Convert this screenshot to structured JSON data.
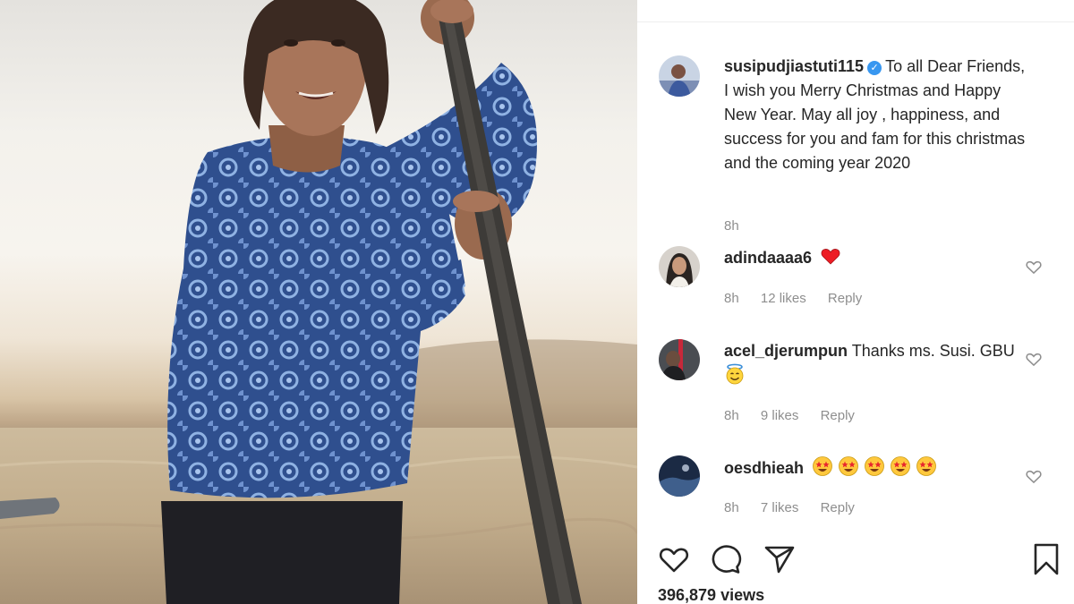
{
  "post": {
    "username": "susipudjiastuti115",
    "verified_glyph": "✓",
    "caption": "To all Dear Friends, I wish you Merry Christmas and Happy New Year. May all joy , happiness, and success for you and fam for this christmas and the coming year 2020",
    "time": "8h",
    "views": "396,879 views"
  },
  "comments": [
    {
      "username": "adindaaaa6",
      "text": "",
      "emoji": "red-heart",
      "time": "8h",
      "likes": "12 likes",
      "reply": "Reply"
    },
    {
      "username": "acel_djerumpun",
      "text": "Thanks ms. Susi. GBU",
      "emoji": "smiling-face-with-halo",
      "time": "8h",
      "likes": "9 likes",
      "reply": "Reply"
    },
    {
      "username": "oesdhieah",
      "text": "",
      "emoji": "star-struck-x5",
      "time": "8h",
      "likes": "7 likes",
      "reply": "Reply"
    }
  ],
  "actions": {
    "like_icon": "heart-outline-icon",
    "comment_icon": "comment-bubble-icon",
    "share_icon": "paper-plane-icon",
    "save_icon": "bookmark-icon"
  },
  "colors": {
    "verified": "#3897f0",
    "heart": "#ed1c24",
    "muted_text": "#8e8e8e"
  }
}
